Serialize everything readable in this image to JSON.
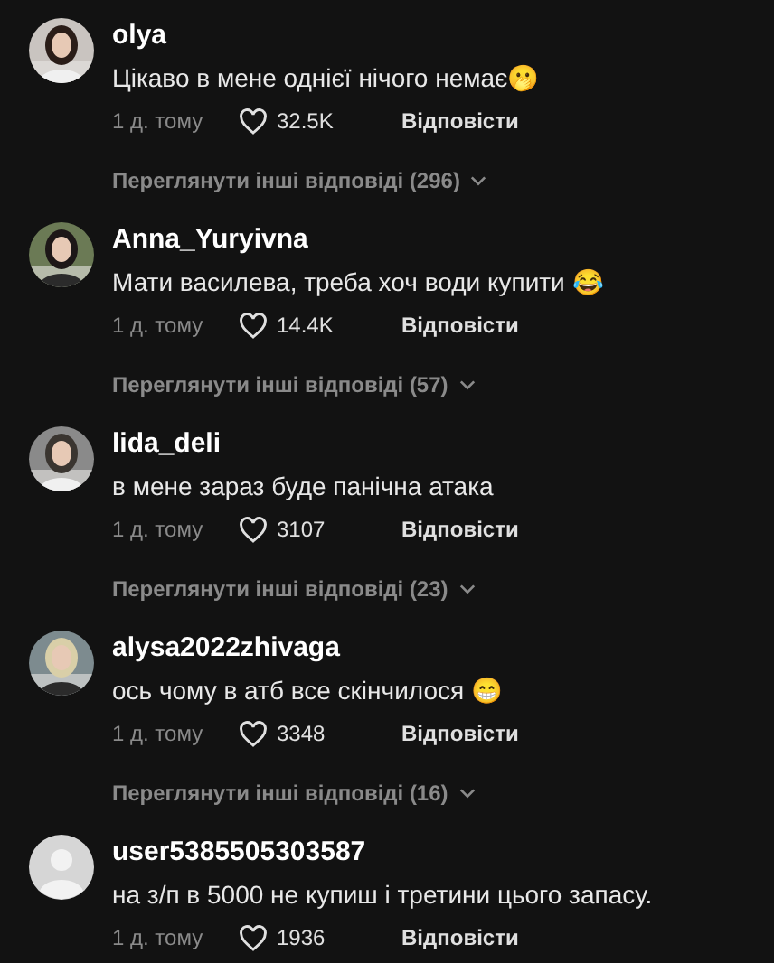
{
  "comments": [
    {
      "username": "olya",
      "text": "Цікаво в мене однієї нічого немає🫢",
      "time": "1 д. тому",
      "likes": "32.5K",
      "reply": "Відповісти",
      "more_replies": "Переглянути інші відповіді (296)"
    },
    {
      "username": "Anna_Yuryivna",
      "text": "Мати василева, треба хоч води купити 😂",
      "time": "1 д. тому",
      "likes": "14.4K",
      "reply": "Відповісти",
      "more_replies": "Переглянути інші відповіді (57)"
    },
    {
      "username": "lida_deli",
      "text": "в мене зараз буде панічна атака",
      "time": "1 д. тому",
      "likes": "3107",
      "reply": "Відповісти",
      "more_replies": "Переглянути інші відповіді (23)"
    },
    {
      "username": "alysa2022zhivaga",
      "text": "ось чому в атб все скінчилося 😁",
      "time": "1 д. тому",
      "likes": "3348",
      "reply": "Відповісти",
      "more_replies": "Переглянути інші відповіді (16)"
    },
    {
      "avatar": {
        "kind": "default"
      },
      "username": "user5385505303587",
      "text": "на з/п в 5000 не купиш і третини цього запасу.",
      "time": "1 д. тому",
      "likes": "1936",
      "reply": "Відповісти"
    }
  ]
}
